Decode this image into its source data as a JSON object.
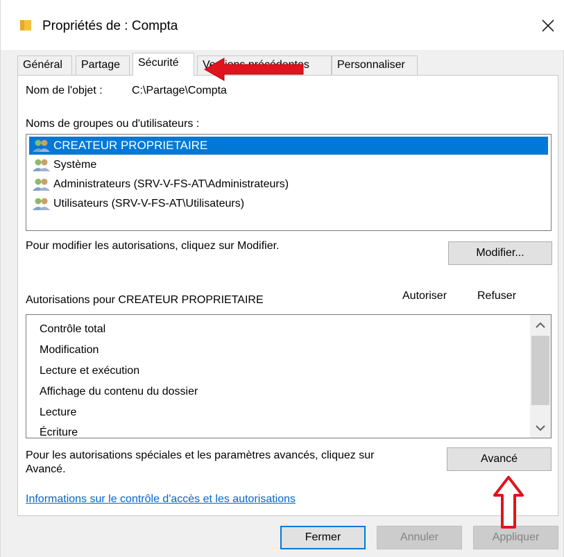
{
  "window": {
    "title": "Propriétés de : Compta",
    "close_label": "✕"
  },
  "tabs": [
    {
      "label": "Général",
      "active": false
    },
    {
      "label": "Partage",
      "active": false
    },
    {
      "label": "Sécurité",
      "active": true
    },
    {
      "label": "Versions précédentes",
      "active": false
    },
    {
      "label": "Personnaliser",
      "active": false
    }
  ],
  "security": {
    "object_name_label": "Nom de l'objet :",
    "object_name_value": "C:\\Partage\\Compta",
    "groups_label": "Noms de groupes ou d'utilisateurs :",
    "users": [
      {
        "name": "CREATEUR PROPRIETAIRE",
        "selected": true
      },
      {
        "name": "Système",
        "selected": false
      },
      {
        "name": "Administrateurs (SRV-V-FS-AT\\Administrateurs)",
        "selected": false
      },
      {
        "name": "Utilisateurs (SRV-V-FS-AT\\Utilisateurs)",
        "selected": false
      }
    ],
    "modify_hint": "Pour modifier les autorisations, cliquez sur Modifier.",
    "modify_button": "Modifier...",
    "permissions_label": "Autorisations pour CREATEUR PROPRIETAIRE",
    "allow_header": "Autoriser",
    "deny_header": "Refuser",
    "permissions": [
      "Contrôle total",
      "Modification",
      "Lecture et exécution",
      "Affichage du contenu du dossier",
      "Lecture",
      "Écriture"
    ],
    "advanced_hint_line1": "Pour les autorisations spéciales et les paramètres avancés, cliquez sur",
    "advanced_hint_line2": "Avancé.",
    "advanced_button": "Avancé",
    "help_link": "Informations sur le contrôle d'accès et les autorisations"
  },
  "buttons": {
    "close": "Fermer",
    "cancel": "Annuler",
    "apply": "Appliquer"
  },
  "colors": {
    "selection": "#0078d7",
    "annotation_arrow": "#e0141e",
    "link": "#0066cc"
  }
}
